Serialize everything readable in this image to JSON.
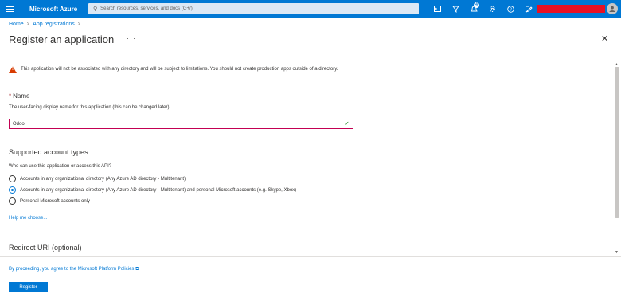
{
  "topbar": {
    "brand": "Microsoft Azure",
    "search_placeholder": "Search resources, services, and docs (G+/)",
    "notification_count": "4",
    "icons": [
      "cloud-shell-icon",
      "directory-filter-icon",
      "notifications-icon",
      "settings-icon",
      "help-icon",
      "feedback-icon"
    ]
  },
  "breadcrumb": {
    "home": "Home",
    "app_registrations": "App registrations"
  },
  "page": {
    "title": "Register an application",
    "more": "···"
  },
  "warning": {
    "text": "This application will not be associated with any directory and will be subject to limitations. You should not create production apps outside of a directory."
  },
  "name_section": {
    "required_mark": "*",
    "label": "Name",
    "description": "The user-facing display name for this application (this can be changed later).",
    "value": "Odoo"
  },
  "account_types": {
    "title": "Supported account types",
    "question": "Who can use this application or access this API?",
    "options": [
      {
        "label": "Accounts in any organizational directory (Any Azure AD directory - Multitenant)",
        "selected": false
      },
      {
        "label": "Accounts in any organizational directory (Any Azure AD directory - Multitenant) and personal Microsoft accounts (e.g. Skype, Xbox)",
        "selected": true
      },
      {
        "label": "Personal Microsoft accounts only",
        "selected": false
      }
    ],
    "help_link": "Help me choose..."
  },
  "redirect": {
    "title": "Redirect URI (optional)"
  },
  "footer": {
    "policy_text": "By proceeding, you agree to the Microsoft Platform Policies ⧉",
    "register_label": "Register"
  },
  "colors": {
    "azure_blue": "#0078d4",
    "warning": "#d83b01",
    "input_border": "#c30052",
    "valid_check": "#107c10"
  }
}
